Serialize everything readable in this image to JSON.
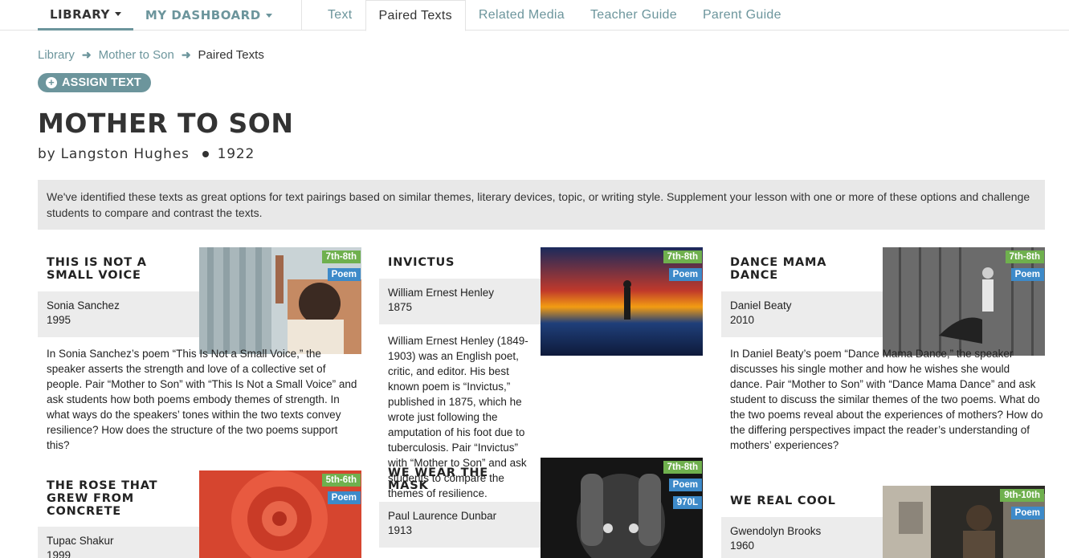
{
  "nav": {
    "library_label": "LIBRARY",
    "dashboard_label": "MY DASHBOARD",
    "tabs": [
      "Text",
      "Paired Texts",
      "Related Media",
      "Teacher Guide",
      "Parent Guide"
    ],
    "active_tab": "Paired Texts"
  },
  "breadcrumb": {
    "items": [
      "Library",
      "Mother to Son"
    ],
    "current": "Paired Texts"
  },
  "assign_label": "ASSIGN TEXT",
  "title": "MOTHER TO SON",
  "author_line": "by Langston Hughes",
  "year": "1922",
  "intro": "We've identified these texts as great options for text pairings based on similar themes, literary devices, topic, or writing style. Supplement your lesson with one or more of these options and challenge students to compare and contrast the texts.",
  "colors": {
    "accent": "#6c959c",
    "grade_badge": "#6fb04e",
    "genre_badge": "#3d8ac9",
    "panel": "#e8e8e8"
  },
  "cards": [
    {
      "title": "THIS IS NOT A SMALL VOICE",
      "author": "Sonia Sanchez",
      "year": "1995",
      "grade": "7th-8th",
      "genre": "Poem",
      "description": "In Sonia Sanchez’s poem “This Is Not a Small Voice,” the speaker asserts the strength and love of a collective set of people. Pair “Mother to Son” with “This Is Not a Small Voice” and ask students how both poems embody themes of strength. In what ways do the speakers’ tones within the two texts convey resilience? How does the structure of the two poems support this?"
    },
    {
      "title": "INVICTUS",
      "author": "William Ernest Henley",
      "year": "1875",
      "grade": "7th-8th",
      "genre": "Poem",
      "description": "William Ernest Henley (1849-1903) was an English poet, critic, and editor. His best known poem is “Invictus,” published in 1875, which he wrote just following the amputation of his foot due to tuberculosis. Pair “Invictus” with “Mother to Son” and ask students to compare the themes of resilience."
    },
    {
      "title": "DANCE MAMA DANCE",
      "author": "Daniel Beaty",
      "year": "2010",
      "grade": "7th-8th",
      "genre": "Poem",
      "description": "In Daniel Beaty’s poem “Dance Mama Dance,” the speaker discusses his single mother and how he wishes she would dance. Pair “Mother to Son” with “Dance Mama Dance” and ask student to discuss the similar themes of the two poems. What do the two poems reveal about the experiences of mothers? How do the differing perspectives impact the reader’s understanding of mothers’ experiences?"
    },
    {
      "title": "THE ROSE THAT GREW FROM CONCRETE",
      "author": "Tupac Shakur",
      "year": "1999",
      "grade": "5th-6th",
      "genre": "Poem"
    },
    {
      "title": "WE WEAR THE MASK",
      "author": "Paul Laurence Dunbar",
      "year": "1913",
      "grade": "7th-8th",
      "genre": "Poem",
      "lexile": "970L"
    },
    {
      "title": "WE REAL COOL",
      "author": "Gwendolyn Brooks",
      "year": "1960",
      "grade": "9th-10th",
      "genre": "Poem"
    }
  ]
}
